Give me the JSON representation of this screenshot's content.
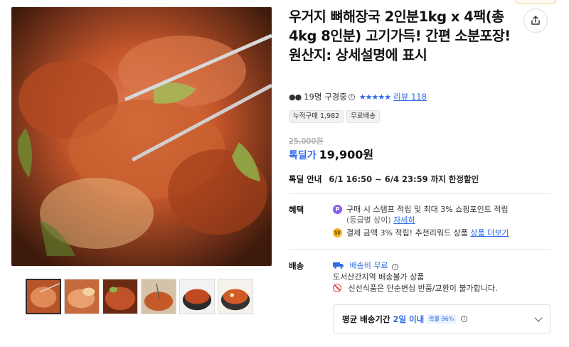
{
  "product": {
    "title": "우거지 뼈해장국 2인분1kg x 4팩(총 4kg 8인분) 고기가득! 간편 소분포장! 원산지: 상세설명에 표시",
    "viewers": "19명 구경중",
    "stars": "★★★★★",
    "review_link": "리뷰 118",
    "tags": [
      "누적구매 1,982",
      "무료배송"
    ],
    "original_price": "25,000원",
    "sale_label": "톡딜가",
    "sale_price": "19,900원",
    "deal_label": "톡딜 안내",
    "deal_text": "6/1 16:50 ~ 6/4 23:59 까지 한정할인"
  },
  "benefit": {
    "label": "혜택",
    "line1": "구매 시 스탬프 적립 및 최대 3% 쇼핑포인트 적립",
    "line1_note": "(등급별 상이)",
    "line1_link": "자세히",
    "line2": "결제 금액 3% 적립! 추천리워드 상품",
    "line2_link": "상품 더보기"
  },
  "shipping": {
    "label": "배송",
    "fee": "배송비 무료",
    "restriction": "도서산간지역 배송불가 상품",
    "notice": "신선식품은 단순변심 반품/교환이 불가합니다.",
    "avg_label": "평균 배송기간",
    "avg_value": "2일 이내",
    "avg_badge": "확률 96%"
  },
  "colors": {
    "accent_blue": "#2f6be6",
    "warning_red": "#e2453c"
  },
  "icons": [
    "share-icon",
    "eyes-icon",
    "info-icon",
    "coin-p-icon",
    "coin-w-icon",
    "truck-icon",
    "no-entry-icon",
    "chevron-down-icon"
  ]
}
